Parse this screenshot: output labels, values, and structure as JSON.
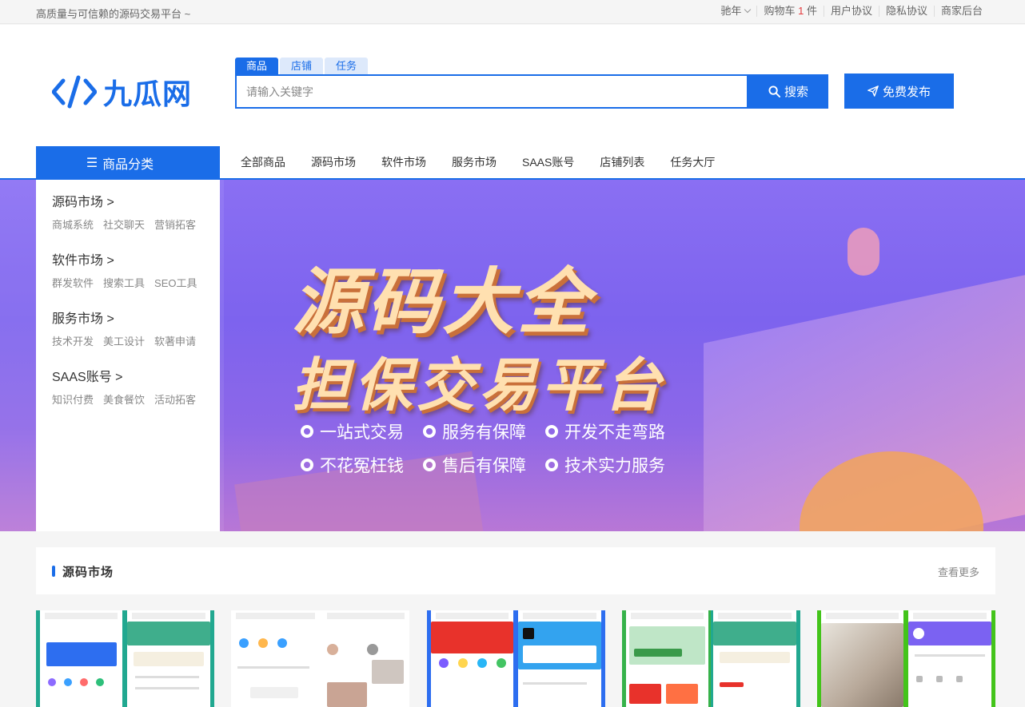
{
  "topbar": {
    "slogan": "高质量与可信赖的源码交易平台 ~",
    "user": "驰年",
    "cart_label": "购物车",
    "cart_count": "1",
    "cart_unit": "件",
    "agreement": "用户协议",
    "privacy": "隐私协议",
    "merchant": "商家后台"
  },
  "logo": {
    "text": "九瓜网"
  },
  "search": {
    "tabs": [
      "商品",
      "店铺",
      "任务"
    ],
    "placeholder": "请输入关键字",
    "button": "搜索",
    "publish": "免费发布"
  },
  "nav": {
    "category_label": "商品分类",
    "links": [
      "全部商品",
      "源码市场",
      "软件市场",
      "服务市场",
      "SAAS账号",
      "店铺列表",
      "任务大厅"
    ]
  },
  "sidebar": [
    {
      "title": "源码市场 >",
      "subs": [
        "商城系统",
        "社交聊天",
        "营销拓客"
      ]
    },
    {
      "title": "软件市场 >",
      "subs": [
        "群发软件",
        "搜索工具",
        "SEO工具"
      ]
    },
    {
      "title": "服务市场 >",
      "subs": [
        "技术开发",
        "美工设计",
        "软著申请"
      ]
    },
    {
      "title": "SAAS账号 >",
      "subs": [
        "知识付费",
        "美食餐饮",
        "活动拓客"
      ]
    }
  ],
  "banner": {
    "line1": "源码大全",
    "line2": "担保交易平台",
    "features": [
      "一站式交易",
      "服务有保障",
      "开发不走弯路",
      "不花冤枉钱",
      "售后有保障",
      "技术实力服务"
    ]
  },
  "section": {
    "title": "源码市场",
    "more": "查看更多"
  },
  "colors": {
    "brand": "#1a6de8",
    "accent_red": "#e4393c"
  }
}
